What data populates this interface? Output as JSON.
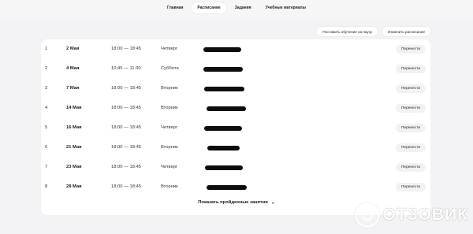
{
  "tabs": [
    {
      "label": "Главная",
      "active": false
    },
    {
      "label": "Расписание",
      "active": true
    },
    {
      "label": "Задания",
      "active": false
    },
    {
      "label": "Учебные материалы",
      "active": false
    }
  ],
  "actions": {
    "pause_label": "Поставить обучение на паузу",
    "change_label": "Изменить расписание"
  },
  "lessons": [
    {
      "num": "1",
      "date": "2 Мая",
      "time": "18:00 — 18:45",
      "day": "Четверг",
      "move": "Перенести"
    },
    {
      "num": "2",
      "date": "4 Мая",
      "time": "10:45 — 11:30",
      "day": "Суббота",
      "move": "Перенести"
    },
    {
      "num": "3",
      "date": "7 Мая",
      "time": "18:00 — 18:45",
      "day": "Вторник",
      "move": "Перенести"
    },
    {
      "num": "4",
      "date": "14 Мая",
      "time": "18:00 — 18:45",
      "day": "Вторник",
      "move": "Перенести"
    },
    {
      "num": "5",
      "date": "16 Мая",
      "time": "18:00 — 18:45",
      "day": "Четверг",
      "move": "Перенести"
    },
    {
      "num": "6",
      "date": "21 Мая",
      "time": "18:00 — 18:45",
      "day": "Вторник",
      "move": "Перенести"
    },
    {
      "num": "7",
      "date": "23 Мая",
      "time": "18:00 — 18:45",
      "day": "Четверг",
      "move": "Перенести"
    },
    {
      "num": "8",
      "date": "28 Мая",
      "time": "18:00 — 18:45",
      "day": "Вторник",
      "move": "Перенести"
    }
  ],
  "show_past_label": "Показать пройденные занятия",
  "watermark": "ОТЗОВИК"
}
